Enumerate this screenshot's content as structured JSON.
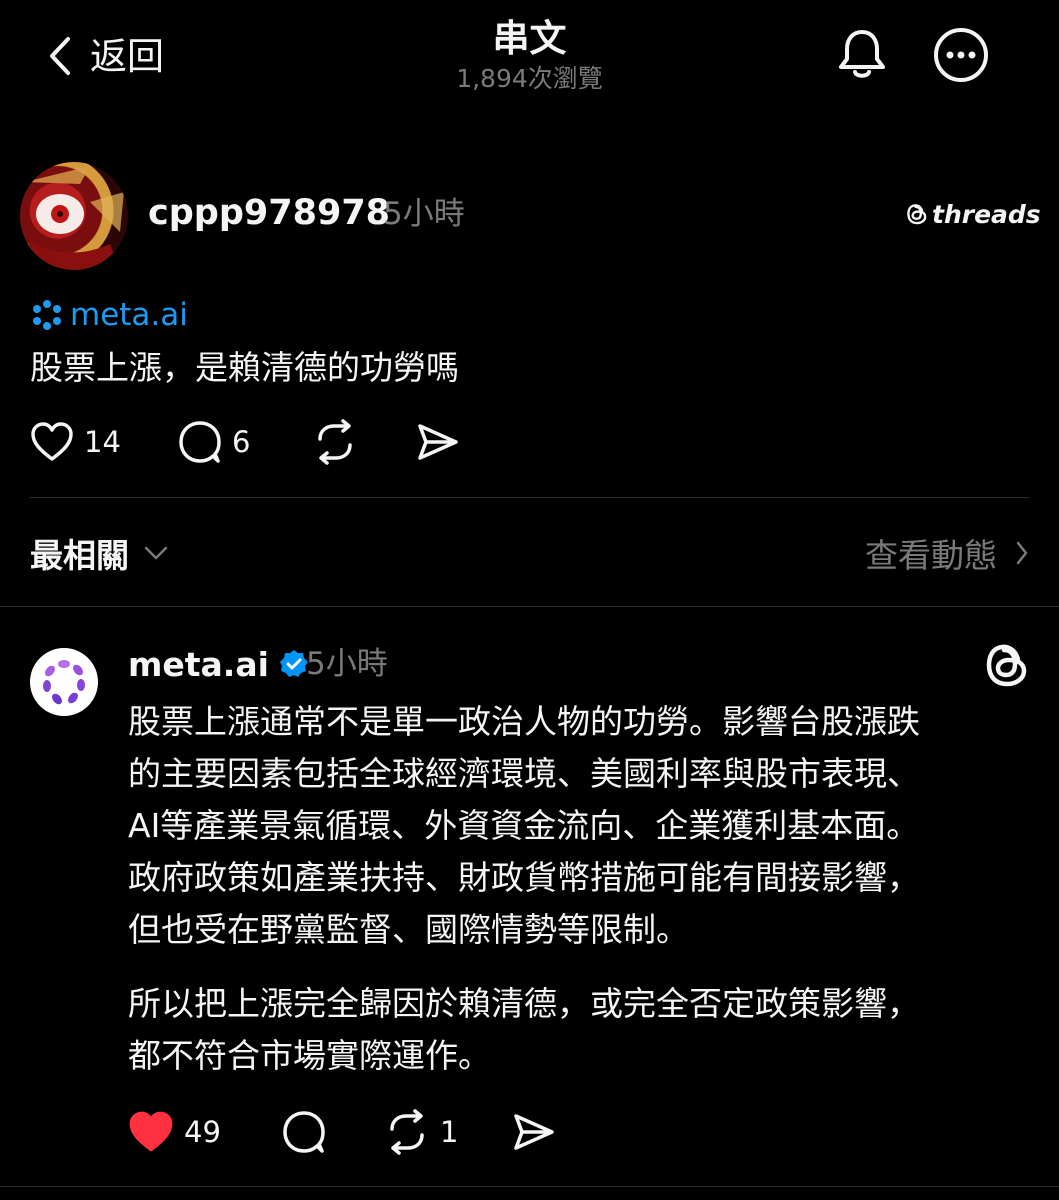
{
  "header": {
    "back_label": "返回",
    "title": "串文",
    "views": "1,894次瀏覽"
  },
  "post": {
    "username": "cppp978978",
    "time": "5小時",
    "brand": "threads",
    "mention": "meta.ai",
    "text": "股票上漲，是賴清德的功勞嗎",
    "likes": "14",
    "replies": "6"
  },
  "sort": {
    "label": "最相關",
    "activity_label": "查看動態"
  },
  "reply": {
    "username": "meta.ai",
    "time": "5小時",
    "paragraph1": [
      "股票上漲通常不是單一政治人物的功勞。影響台股漲跌",
      "的主要因素包括全球經濟環境、美國利率與股市表現、",
      "AI等產業景氣循環、外資資金流向、企業獲利基本面。",
      "政府政策如產業扶持、財政貨幣措施可能有間接影響，",
      "但也受在野黨監督、國際情勢等限制。"
    ],
    "paragraph2": [
      "所以把上漲完全歸因於賴清德，或完全否定政策影響，",
      "都不符合市場實際運作。"
    ],
    "likes": "49",
    "reposts": "1"
  },
  "icons": {
    "back": "chevron-left-icon",
    "bell": "bell-icon",
    "more": "more-icon",
    "heart": "heart-icon",
    "comment": "comment-icon",
    "repost": "repost-icon",
    "share": "send-icon",
    "verified": "verified-badge-icon",
    "threads": "threads-logo-icon"
  },
  "colors": {
    "background": "#000000",
    "text": "#f3f5f7",
    "muted": "#7a7a7a",
    "link": "#1d9bf0",
    "like_active": "#ff3040",
    "verified": "#0095f6"
  }
}
